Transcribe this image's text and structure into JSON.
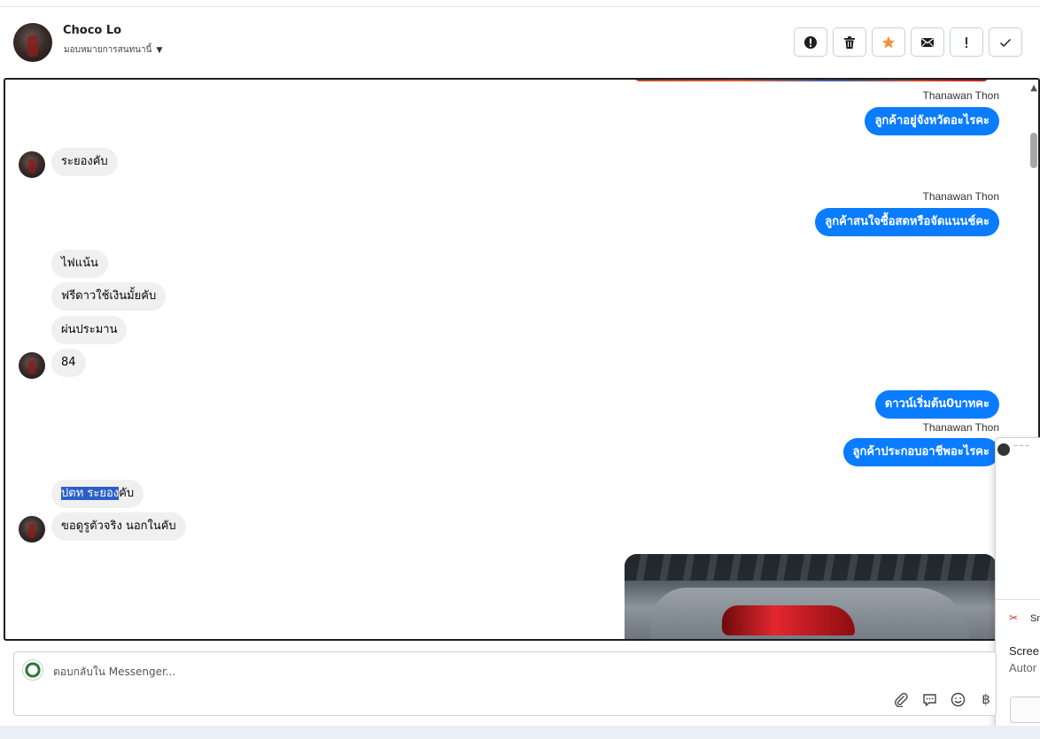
{
  "header": {
    "contact_name": "Choco Lo",
    "assign_label": "มอบหมายการสนทนานี้",
    "actions": [
      {
        "name": "spam-button",
        "icon": "alert-circle-icon"
      },
      {
        "name": "delete-button",
        "icon": "trash-icon"
      },
      {
        "name": "star-button",
        "icon": "star-icon",
        "color": "#f7923a"
      },
      {
        "name": "mark-unread-button",
        "icon": "envelope-icon"
      },
      {
        "name": "follow-up-button",
        "icon": "exclamation-icon"
      },
      {
        "name": "done-button",
        "icon": "checkmark-icon"
      }
    ]
  },
  "messages": [
    {
      "type": "sender",
      "text": "Thanawan Thon"
    },
    {
      "type": "out",
      "text": "ลูกค้าอยู่จังหวัดอะไรคะ"
    },
    {
      "type": "in",
      "text": "ระยองคับ"
    },
    {
      "type": "sender",
      "text": "Thanawan Thon"
    },
    {
      "type": "out",
      "text": "ลูกค้าสนใจซื้อสดหรือจัดแนนช์คะ"
    },
    {
      "type": "in",
      "text": "ไฟแน้น"
    },
    {
      "type": "in",
      "text": "ฟรีดาวใช้เงินมั้ยคับ"
    },
    {
      "type": "in",
      "text": "ผ่นประมาน"
    },
    {
      "type": "in",
      "text": "84"
    },
    {
      "type": "out",
      "text": "ดาวน์เริ่มต้น0บาทคะ"
    },
    {
      "type": "sender",
      "text": "Thanawan Thon"
    },
    {
      "type": "out",
      "text": "ลูกค้าประกอบอาชีพอะไรคะ"
    },
    {
      "type": "in",
      "text_highlighted": "ปตท ระยอง",
      "text_rest": "คับ"
    },
    {
      "type": "in",
      "text": "ขอดูรูตัวจริง นอกในคับ"
    }
  ],
  "snip": {
    "app_name": "Sn",
    "title": "Scree",
    "subtitle": "Autor"
  },
  "composer": {
    "placeholder": "ตอบกลับใน Messenger...",
    "tools": [
      "paperclip-icon",
      "chat-bubble-icon",
      "emoji-icon",
      "baht-icon"
    ]
  },
  "colors": {
    "outgoing_bubble": "#0a7cff",
    "incoming_bubble": "#f0f0f0",
    "star": "#f7923a",
    "highlight": "#2d5fc9"
  }
}
